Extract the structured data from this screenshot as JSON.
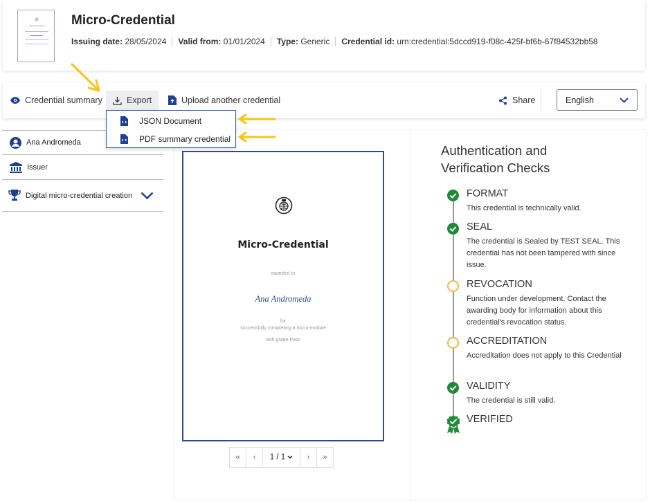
{
  "header": {
    "title": "Micro-Credential",
    "meta": [
      {
        "label": "Issuing date:",
        "value": "28/05/2024"
      },
      {
        "label": "Valid from:",
        "value": "01/01/2024"
      },
      {
        "label": "Type:",
        "value": "Generic"
      },
      {
        "label": "Credential id:",
        "value": "urn:credential:5dccd919-f08c-425f-bf6b-67f84532bb58"
      }
    ]
  },
  "toolbar": {
    "summary_label": "Credential summary",
    "export_label": "Export",
    "upload_label": "Upload another credential",
    "share_label": "Share",
    "language_value": "English"
  },
  "export_menu": {
    "items": [
      {
        "label": "JSON Document"
      },
      {
        "label": "PDF summary credential"
      }
    ]
  },
  "sidebar": {
    "items": [
      {
        "label": "Ana Andromeda",
        "icon": "user-circle-icon"
      },
      {
        "label": "Issuer",
        "icon": "bank-icon"
      },
      {
        "label": "Digital micro-credential creation",
        "icon": "trophy-icon"
      }
    ]
  },
  "document": {
    "title": "Micro-Credential",
    "awarded_to": "awarded to",
    "name": "Ana Andromeda",
    "for": "for",
    "reason": "successfully completing a micro-module",
    "grade": "with grade Pass"
  },
  "pager": {
    "first": "«",
    "prev": "‹",
    "page": "1 / 1",
    "next": "›",
    "last": "»"
  },
  "checks": {
    "title": "Authentication and Verification Checks",
    "steps": [
      {
        "name": "FORMAT",
        "status": "ok",
        "desc": "This credential is technically valid."
      },
      {
        "name": "SEAL",
        "status": "ok",
        "desc": "The credential is Sealed by TEST SEAL. This credential has not been tampered with since issue."
      },
      {
        "name": "REVOCATION",
        "status": "pending",
        "desc": "Function under development. Contact the awarding body for information about this credential's revocation status."
      },
      {
        "name": "ACCREDITATION",
        "status": "pending",
        "desc": "Accreditation does not apply to this Credential"
      },
      {
        "name": "VALIDITY",
        "status": "ok",
        "desc": "The credential is still valid."
      },
      {
        "name": "VERIFIED",
        "status": "verified",
        "desc": ""
      }
    ]
  },
  "colors": {
    "accent": "#1f3f8f",
    "ok": "#1e8a3a",
    "pending": "#f0b84a",
    "annotation_arrow": "#f5c518"
  }
}
